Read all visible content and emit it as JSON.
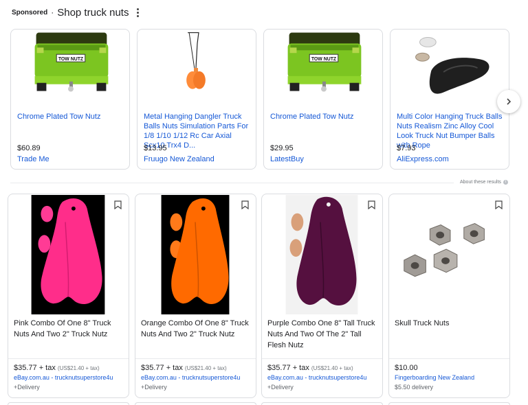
{
  "header": {
    "sponsored": "Sponsored",
    "separator": "·",
    "title": "Shop truck nuts"
  },
  "carousel": [
    {
      "title": "Chrome Plated Tow Nutz",
      "price": "$60.89",
      "seller": "Trade Me",
      "image": "green-truck-tow-nutz",
      "plate": "TOW NUTZ"
    },
    {
      "title": "Metal Hanging Dangler Truck Balls Nuts Simulation Parts For 1/8 1/10 1/12 Rc Car Axial Scx10 Trx4 D...",
      "price": "$13.95",
      "seller": "Fruugo New Zealand",
      "image": "orange-hanging-dangler"
    },
    {
      "title": "Chrome Plated Tow Nutz",
      "price": "$29.95",
      "seller": "LatestBuy",
      "image": "green-truck-tow-nutz",
      "plate": "TOW NUTZ"
    },
    {
      "title": "Multi Color Hanging Truck Balls Nuts Realism Zinc Alloy Cool Look Truck Nut Bumper Balls with Rope",
      "price": "$7.93",
      "seller": "AliExpress.com",
      "image": "black-metal-truck-nuts"
    }
  ],
  "next_icon": "chevron-right-icon",
  "about": "About these results",
  "products": [
    {
      "title": "Pink Combo Of One 8\" Truck Nuts And Two 2\" Truck Nutz",
      "price": "$35.77 + tax",
      "tax_note": "(US$21.40 + tax)",
      "seller": "eBay.com.au - trucknutsuperstore4u",
      "delivery": "+Delivery",
      "color": "#ff2d8a",
      "bg": "#000000"
    },
    {
      "title": "Orange Combo Of One 8\" Truck Nuts And Two 2\" Truck Nutz",
      "price": "$35.77 + tax",
      "tax_note": "(US$21.40 + tax)",
      "seller": "eBay.com.au - trucknutsuperstore4u",
      "delivery": "+Delivery",
      "color": "#ff6a00",
      "bg": "#000000"
    },
    {
      "title": "Purple Combo One 8\" Tall Truck Nuts And Two Of The 2\" Tall Flesh Nutz",
      "price": "$35.77 + tax",
      "tax_note": "(US$21.40 + tax)",
      "seller": "eBay.com.au - trucknutsuperstore4u",
      "delivery": "+Delivery",
      "color": "#55103f",
      "bg": "#f2f2f2"
    },
    {
      "title": "Skull Truck Nuts",
      "price": "$10.00",
      "tax_note": "",
      "seller": "Fingerboarding New Zealand",
      "delivery": "$5.50 delivery",
      "color": "#9e9a95",
      "bg": "#ffffff"
    }
  ]
}
